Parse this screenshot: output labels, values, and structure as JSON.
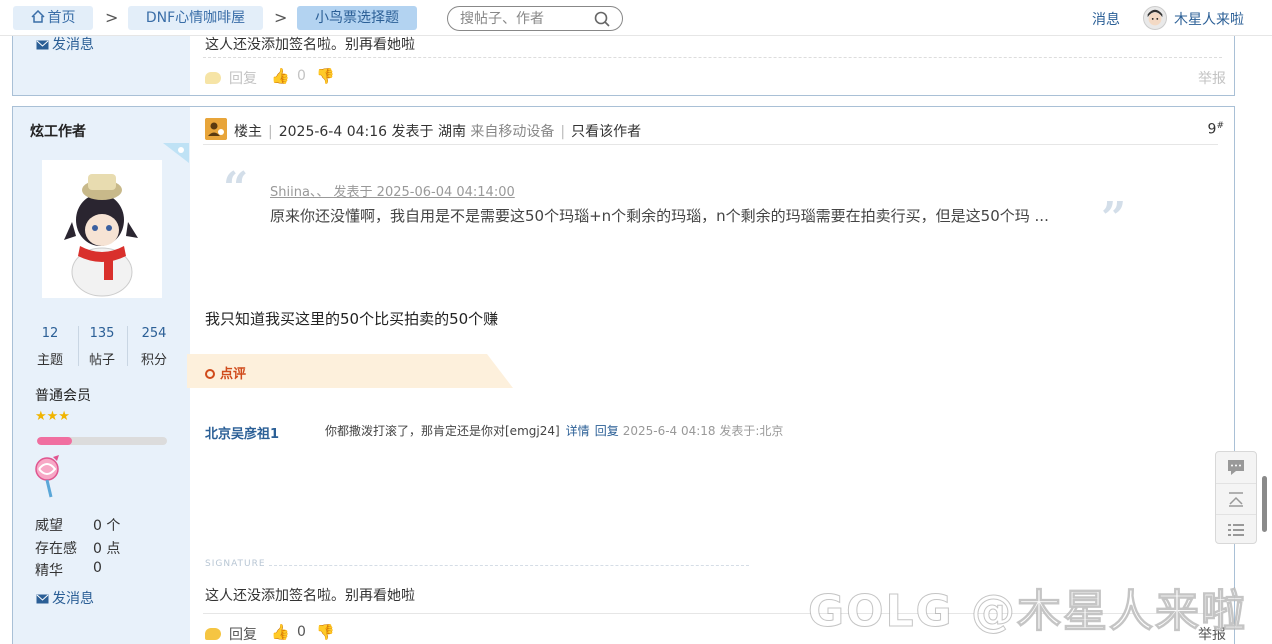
{
  "breadcrumb": {
    "home": "首页",
    "section": "DNF心情咖啡屋",
    "current": "小鸟票选择题"
  },
  "search": {
    "placeholder": "搜帖子、作者"
  },
  "top_right": {
    "messages": "消息",
    "username": "木星人来啦"
  },
  "prev_post": {
    "send_message": "发消息",
    "signature_text": "这人还没添加签名啦。别再看她啦",
    "reply": "回复",
    "likes": "0",
    "report": "举报"
  },
  "post": {
    "author": "炫工作者",
    "stats": [
      {
        "value": "12",
        "label": "主题"
      },
      {
        "value": "135",
        "label": "帖子"
      },
      {
        "value": "254",
        "label": "积分"
      }
    ],
    "rank": "普通会员",
    "stars": "★★★",
    "progress_fraction": 0.27,
    "attributes": [
      {
        "key": "威望",
        "value": "0 个"
      },
      {
        "key": "存在感",
        "value": "0 点"
      },
      {
        "key": "精华",
        "value": "0"
      }
    ],
    "send_message": "发消息",
    "meta": {
      "role": "楼主",
      "datetime": "2025-6-4 04:16",
      "posted_in": "发表于",
      "location": "湖南",
      "device": "来自移动设备",
      "only_author": "只看该作者"
    },
    "floor": "9",
    "floor_mark": "#",
    "quote": {
      "header": "Shiina、、 发表于 2025-06-04 04:14:00",
      "body": "原来你还没懂啊，我自用是不是需要这50个玛瑙+n个剩余的玛瑙，n个剩余的玛瑙需要在拍卖行买，但是这50个玛 ..."
    },
    "content": "我只知道我买这里的50个比买拍卖的50个赚",
    "dianping_label": "点评",
    "comment": {
      "user": "北京吴彦祖1",
      "text": "你都撒泼打滚了，那肯定还是你对[emgj24]",
      "detail": "详情",
      "reply": "回复",
      "time": "2025-6-4 04:18 发表于:北京"
    },
    "signature_label": "SIGNATURE",
    "signature_text": "这人还没添加签名啦。别再看她啦",
    "reply": "回复",
    "likes": "0",
    "report": "举报"
  },
  "watermark": "GOLG @木星人来啦",
  "colors": {
    "accent": "#2b5f96",
    "sidebar": "#e8f1fa",
    "breadcrumb_active": "#b3d3f1"
  }
}
